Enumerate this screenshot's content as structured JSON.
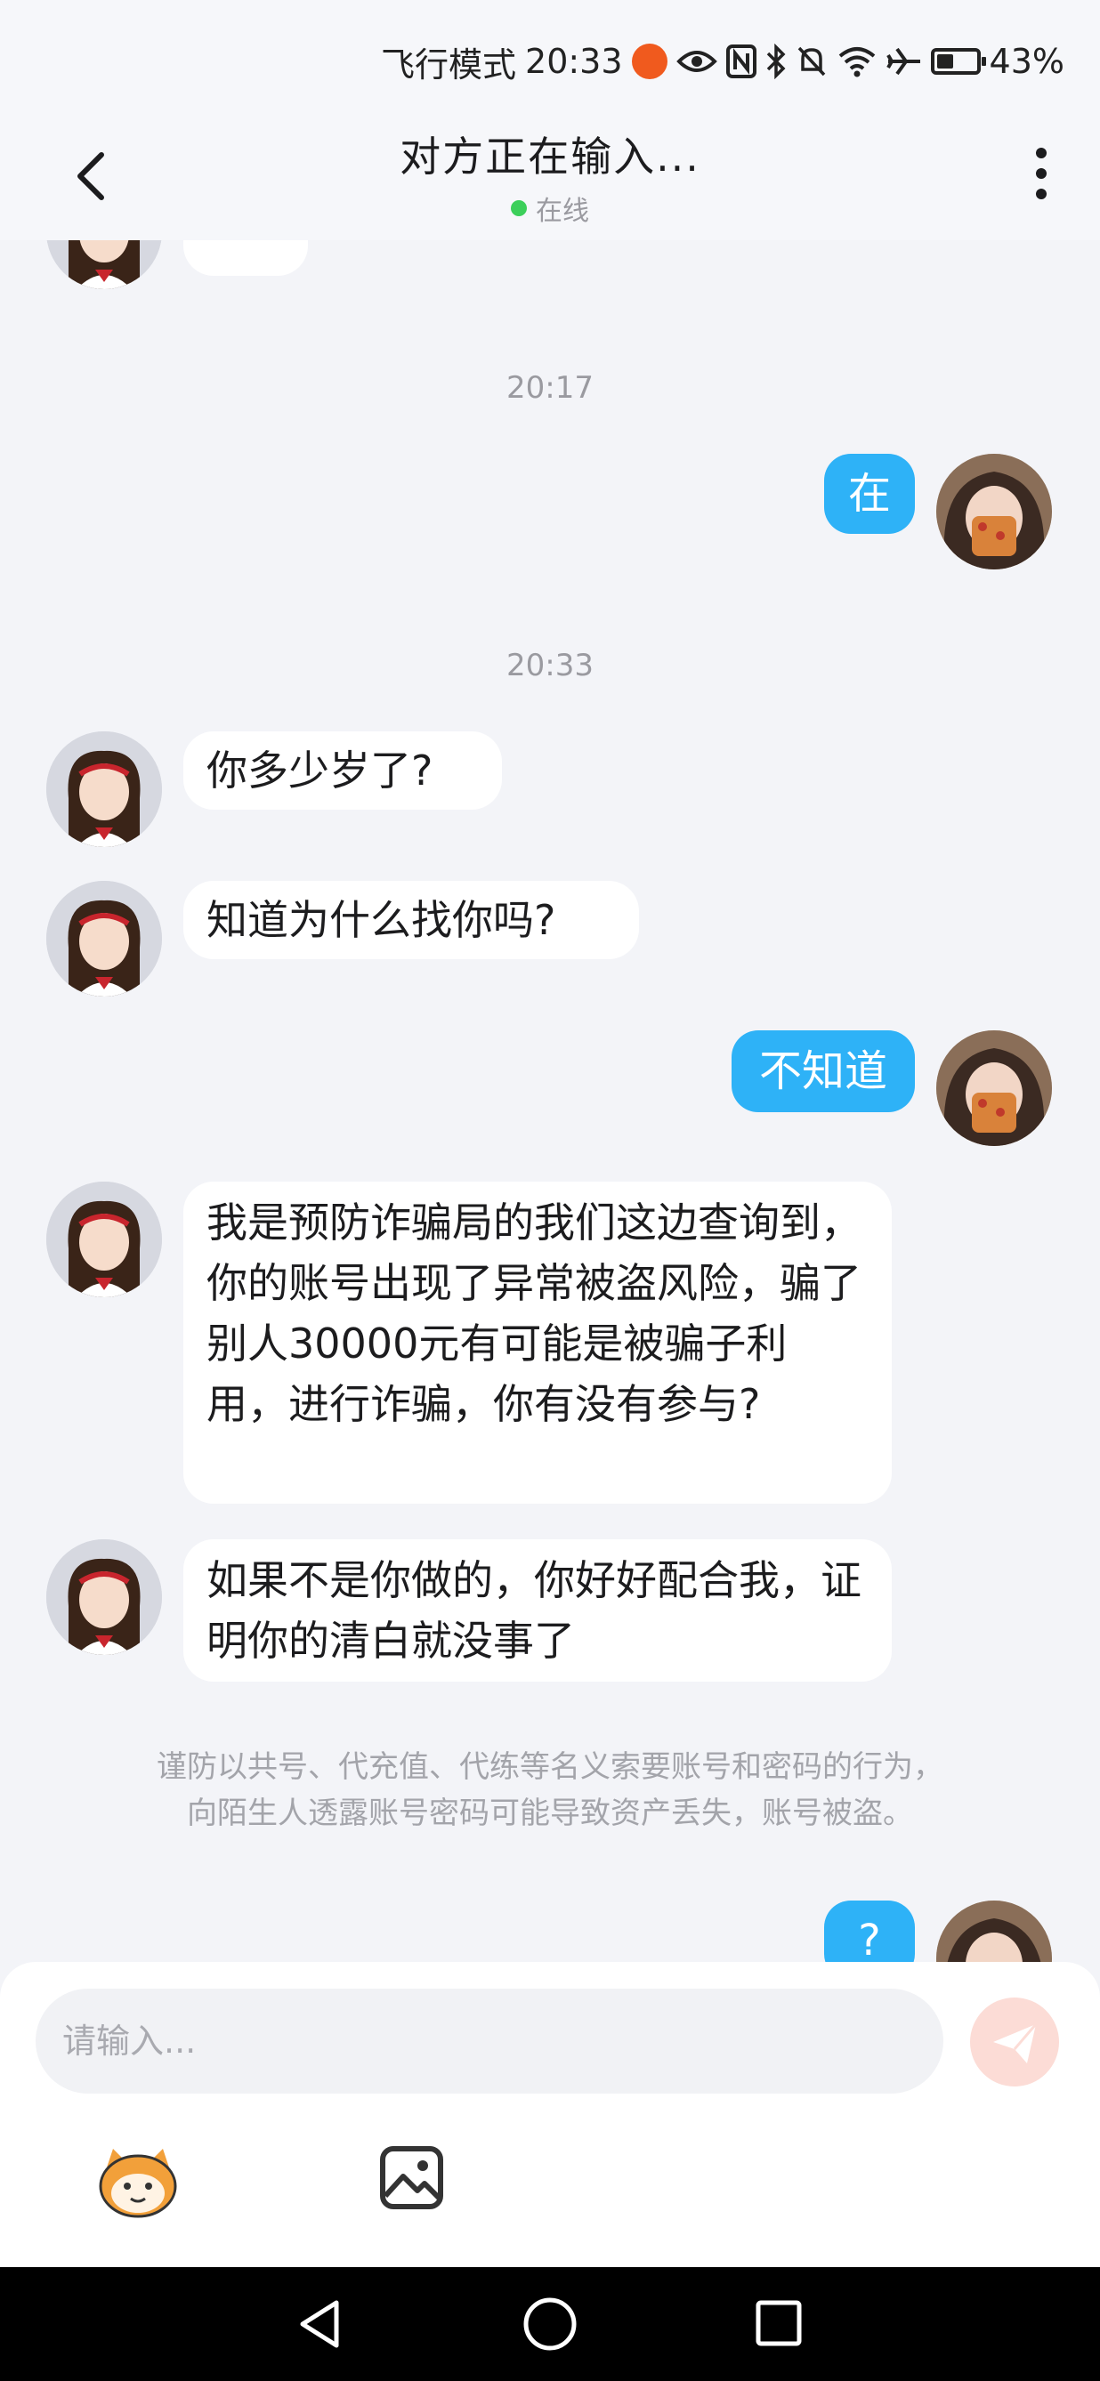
{
  "status_bar": {
    "mode": "飞行模式",
    "time": "20:33",
    "battery": "43%",
    "battery_level": 0.43,
    "icons": [
      "weibo-icon",
      "eye-icon",
      "nfc-icon",
      "bluetooth-icon",
      "mute-icon",
      "wifi-icon",
      "airplane-icon",
      "battery-icon"
    ]
  },
  "header": {
    "title": "对方正在输入...",
    "status": "在线",
    "back_icon": "chevron-left-icon",
    "more_icon": "more-vertical-icon"
  },
  "messages": {
    "time_1": "20:17",
    "time_2": "20:33",
    "m1": "在",
    "m2": "你多少岁了?",
    "m3": "知道为什么找你吗?",
    "m4": "不知道",
    "m5": "我是预防诈骗局的我们这边查询到，你的账号出现了异常被盗风险，骗了别人30000元有可能是被骗子利用，进行诈骗，你有没有参与?",
    "m6": "如果不是你做的，你好好配合我，证明你的清白就没事了",
    "m7": "?"
  },
  "notice": {
    "line1": "谨防以共号、代充值、代练等名义索要账号和密码的行为，",
    "line2": "向陌生人透露账号密码可能导致资产丢失，账号被盗。"
  },
  "input": {
    "placeholder": "请输入...",
    "send_icon": "send-icon",
    "emoji_icon": "mascot-emoji-icon",
    "image_icon": "image-icon"
  },
  "colors": {
    "accent": "#2eb2f7",
    "background": "#f3f4f8",
    "online": "#3ccf5a"
  }
}
